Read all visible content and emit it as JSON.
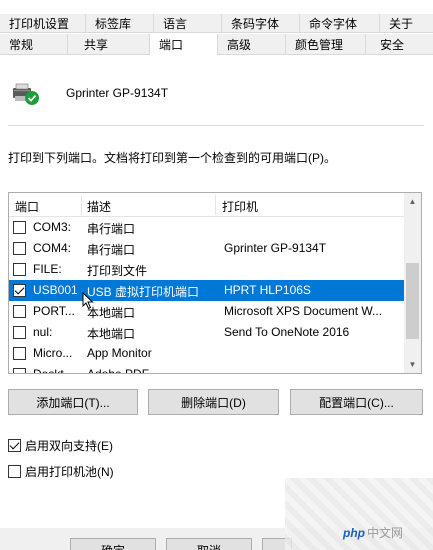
{
  "tabs_row1": [
    "打印机设置",
    "标签库",
    "语言",
    "条码字体",
    "命令字体",
    "关于"
  ],
  "tabs_row2": [
    "常规",
    "共享",
    "端口",
    "高级",
    "颜色管理",
    "安全"
  ],
  "active_tab": "端口",
  "printer": {
    "name": "Gprinter  GP-9134T",
    "icon": "printer-ok-icon"
  },
  "description": "打印到下列端口。文档将打印到第一个检查到的可用端口(P)。",
  "list": {
    "headers": [
      "端口",
      "描述",
      "打印机"
    ],
    "rows": [
      {
        "checked": false,
        "port": "COM3:",
        "desc": "串行端口",
        "printer": "",
        "selected": false
      },
      {
        "checked": false,
        "port": "COM4:",
        "desc": "串行端口",
        "printer": "Gprinter  GP-9134T",
        "selected": false
      },
      {
        "checked": false,
        "port": "FILE:",
        "desc": "打印到文件",
        "printer": "",
        "selected": false
      },
      {
        "checked": true,
        "port": "USB001",
        "desc": "USB 虚拟打印机端口",
        "printer": "HPRT HLP106S",
        "selected": true
      },
      {
        "checked": false,
        "port": "PORT...",
        "desc": "本地端口",
        "printer": "Microsoft XPS Document W...",
        "selected": false
      },
      {
        "checked": false,
        "port": "nul:",
        "desc": "本地端口",
        "printer": "Send To OneNote 2016",
        "selected": false
      },
      {
        "checked": false,
        "port": "Micro...",
        "desc": "App Monitor",
        "printer": "",
        "selected": false
      },
      {
        "checked": false,
        "port": "Deskt...",
        "desc": "Adobe PDF",
        "printer": "",
        "selected": false
      }
    ]
  },
  "buttons": {
    "add": "添加端口(T)...",
    "delete": "删除端口(D)",
    "configure": "配置端口(C)..."
  },
  "options": {
    "bidirectional": {
      "label": "启用双向支持(E)",
      "checked": true
    },
    "pooling": {
      "label": "启用打印机池(N)",
      "checked": false
    }
  },
  "dialog_buttons": {
    "ok": "确定",
    "cancel": "取消"
  },
  "watermark": {
    "logo": "php",
    "text": "中文网"
  },
  "colors": {
    "selection": "#0078d7",
    "button_bg": "#e1e1e1",
    "tab_bg": "#f0f0f0"
  }
}
